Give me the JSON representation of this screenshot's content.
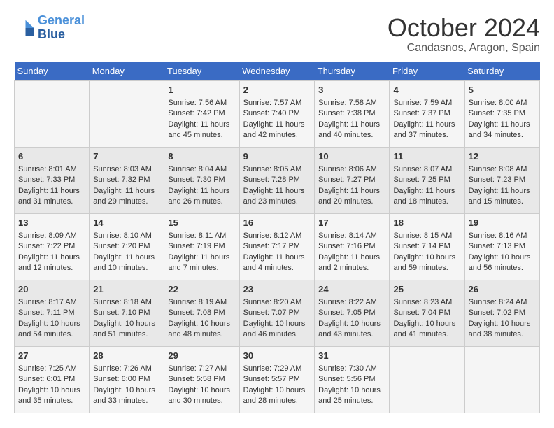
{
  "logo": {
    "line1": "General",
    "line2": "Blue"
  },
  "title": "October 2024",
  "location": "Candasnos, Aragon, Spain",
  "weekdays": [
    "Sunday",
    "Monday",
    "Tuesday",
    "Wednesday",
    "Thursday",
    "Friday",
    "Saturday"
  ],
  "weeks": [
    [
      {
        "day": "",
        "info": ""
      },
      {
        "day": "",
        "info": ""
      },
      {
        "day": "1",
        "info": "Sunrise: 7:56 AM\nSunset: 7:42 PM\nDaylight: 11 hours and 45 minutes."
      },
      {
        "day": "2",
        "info": "Sunrise: 7:57 AM\nSunset: 7:40 PM\nDaylight: 11 hours and 42 minutes."
      },
      {
        "day": "3",
        "info": "Sunrise: 7:58 AM\nSunset: 7:38 PM\nDaylight: 11 hours and 40 minutes."
      },
      {
        "day": "4",
        "info": "Sunrise: 7:59 AM\nSunset: 7:37 PM\nDaylight: 11 hours and 37 minutes."
      },
      {
        "day": "5",
        "info": "Sunrise: 8:00 AM\nSunset: 7:35 PM\nDaylight: 11 hours and 34 minutes."
      }
    ],
    [
      {
        "day": "6",
        "info": "Sunrise: 8:01 AM\nSunset: 7:33 PM\nDaylight: 11 hours and 31 minutes."
      },
      {
        "day": "7",
        "info": "Sunrise: 8:03 AM\nSunset: 7:32 PM\nDaylight: 11 hours and 29 minutes."
      },
      {
        "day": "8",
        "info": "Sunrise: 8:04 AM\nSunset: 7:30 PM\nDaylight: 11 hours and 26 minutes."
      },
      {
        "day": "9",
        "info": "Sunrise: 8:05 AM\nSunset: 7:28 PM\nDaylight: 11 hours and 23 minutes."
      },
      {
        "day": "10",
        "info": "Sunrise: 8:06 AM\nSunset: 7:27 PM\nDaylight: 11 hours and 20 minutes."
      },
      {
        "day": "11",
        "info": "Sunrise: 8:07 AM\nSunset: 7:25 PM\nDaylight: 11 hours and 18 minutes."
      },
      {
        "day": "12",
        "info": "Sunrise: 8:08 AM\nSunset: 7:23 PM\nDaylight: 11 hours and 15 minutes."
      }
    ],
    [
      {
        "day": "13",
        "info": "Sunrise: 8:09 AM\nSunset: 7:22 PM\nDaylight: 11 hours and 12 minutes."
      },
      {
        "day": "14",
        "info": "Sunrise: 8:10 AM\nSunset: 7:20 PM\nDaylight: 11 hours and 10 minutes."
      },
      {
        "day": "15",
        "info": "Sunrise: 8:11 AM\nSunset: 7:19 PM\nDaylight: 11 hours and 7 minutes."
      },
      {
        "day": "16",
        "info": "Sunrise: 8:12 AM\nSunset: 7:17 PM\nDaylight: 11 hours and 4 minutes."
      },
      {
        "day": "17",
        "info": "Sunrise: 8:14 AM\nSunset: 7:16 PM\nDaylight: 11 hours and 2 minutes."
      },
      {
        "day": "18",
        "info": "Sunrise: 8:15 AM\nSunset: 7:14 PM\nDaylight: 10 hours and 59 minutes."
      },
      {
        "day": "19",
        "info": "Sunrise: 8:16 AM\nSunset: 7:13 PM\nDaylight: 10 hours and 56 minutes."
      }
    ],
    [
      {
        "day": "20",
        "info": "Sunrise: 8:17 AM\nSunset: 7:11 PM\nDaylight: 10 hours and 54 minutes."
      },
      {
        "day": "21",
        "info": "Sunrise: 8:18 AM\nSunset: 7:10 PM\nDaylight: 10 hours and 51 minutes."
      },
      {
        "day": "22",
        "info": "Sunrise: 8:19 AM\nSunset: 7:08 PM\nDaylight: 10 hours and 48 minutes."
      },
      {
        "day": "23",
        "info": "Sunrise: 8:20 AM\nSunset: 7:07 PM\nDaylight: 10 hours and 46 minutes."
      },
      {
        "day": "24",
        "info": "Sunrise: 8:22 AM\nSunset: 7:05 PM\nDaylight: 10 hours and 43 minutes."
      },
      {
        "day": "25",
        "info": "Sunrise: 8:23 AM\nSunset: 7:04 PM\nDaylight: 10 hours and 41 minutes."
      },
      {
        "day": "26",
        "info": "Sunrise: 8:24 AM\nSunset: 7:02 PM\nDaylight: 10 hours and 38 minutes."
      }
    ],
    [
      {
        "day": "27",
        "info": "Sunrise: 7:25 AM\nSunset: 6:01 PM\nDaylight: 10 hours and 35 minutes."
      },
      {
        "day": "28",
        "info": "Sunrise: 7:26 AM\nSunset: 6:00 PM\nDaylight: 10 hours and 33 minutes."
      },
      {
        "day": "29",
        "info": "Sunrise: 7:27 AM\nSunset: 5:58 PM\nDaylight: 10 hours and 30 minutes."
      },
      {
        "day": "30",
        "info": "Sunrise: 7:29 AM\nSunset: 5:57 PM\nDaylight: 10 hours and 28 minutes."
      },
      {
        "day": "31",
        "info": "Sunrise: 7:30 AM\nSunset: 5:56 PM\nDaylight: 10 hours and 25 minutes."
      },
      {
        "day": "",
        "info": ""
      },
      {
        "day": "",
        "info": ""
      }
    ]
  ]
}
